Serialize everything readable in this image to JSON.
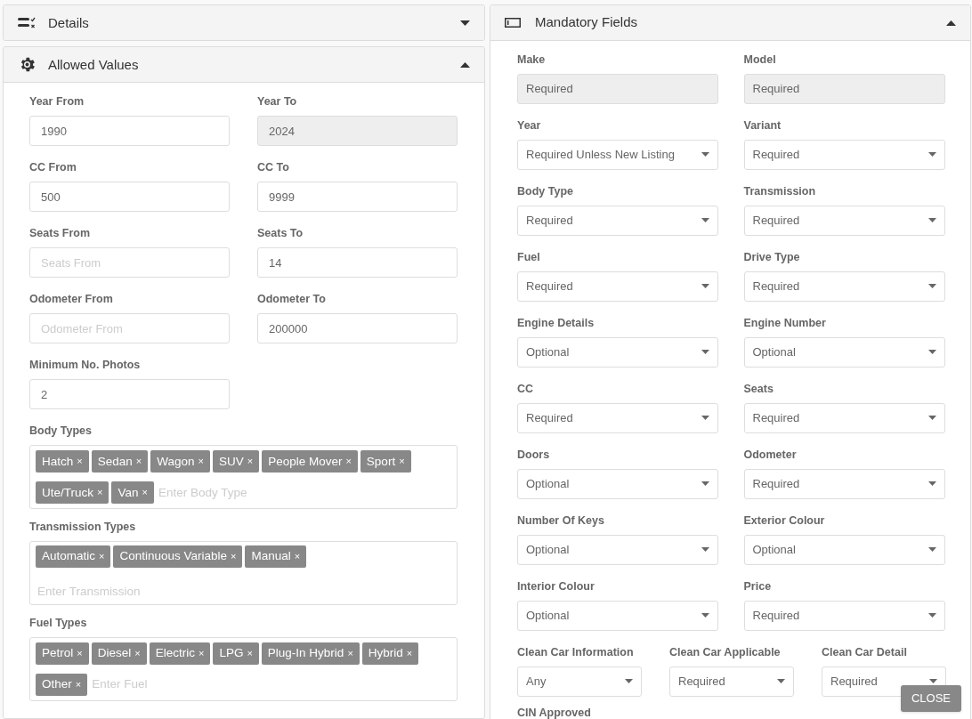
{
  "left_panels": [
    {
      "title": "Details",
      "kind": "list-check",
      "expanded": false
    },
    {
      "title": "Allowed Values",
      "kind": "gear",
      "expanded": true
    }
  ],
  "allowed_values": {
    "fields": [
      {
        "label": "Year From",
        "value": "1990",
        "disabled": false
      },
      {
        "label": "Year To",
        "value": "2024",
        "disabled": true
      },
      {
        "label": "CC From",
        "value": "500",
        "disabled": false
      },
      {
        "label": "CC To",
        "value": "9999",
        "disabled": false
      },
      {
        "label": "Seats From",
        "placeholder": "Seats From",
        "disabled": false
      },
      {
        "label": "Seats To",
        "value": "14",
        "disabled": false
      },
      {
        "label": "Odometer From",
        "placeholder": "Odometer From",
        "disabled": false
      },
      {
        "label": "Odometer To",
        "value": "200000",
        "disabled": false
      },
      {
        "label": "Minimum No. Photos",
        "value": "2",
        "disabled": false
      }
    ],
    "tag_fields": [
      {
        "label": "Body Types",
        "tags": [
          "Hatch",
          "Sedan",
          "Wagon",
          "SUV",
          "People Mover",
          "Sport",
          "Ute/Truck",
          "Van"
        ],
        "placeholder": "Enter Body Type",
        "input_on_new_line": false
      },
      {
        "label": "Transmission Types",
        "tags": [
          "Automatic",
          "Continuous Variable",
          "Manual"
        ],
        "placeholder": "Enter Transmission",
        "input_on_new_line": true
      },
      {
        "label": "Fuel Types",
        "tags": [
          "Petrol",
          "Diesel",
          "Electric",
          "LPG",
          "Plug-In Hybrid",
          "Hybrid",
          "Other"
        ],
        "placeholder": "Enter Fuel",
        "input_on_new_line": false
      }
    ],
    "remove_mark": "×"
  },
  "mandatory_panel": {
    "title": "Mandatory Fields",
    "kind": "rectangle",
    "expanded": true,
    "fields": [
      {
        "label": "Make",
        "value": "Required",
        "kind": "locked"
      },
      {
        "label": "Model",
        "value": "Required",
        "kind": "locked"
      },
      {
        "label": "Year",
        "value": "Required Unless New Listing",
        "kind": "select"
      },
      {
        "label": "Variant",
        "value": "Required",
        "kind": "select"
      },
      {
        "label": "Body Type",
        "value": "Required",
        "kind": "select"
      },
      {
        "label": "Transmission",
        "value": "Required",
        "kind": "select"
      },
      {
        "label": "Fuel",
        "value": "Required",
        "kind": "select"
      },
      {
        "label": "Drive Type",
        "value": "Required",
        "kind": "select"
      },
      {
        "label": "Engine Details",
        "value": "Optional",
        "kind": "select"
      },
      {
        "label": "Engine Number",
        "value": "Optional",
        "kind": "select"
      },
      {
        "label": "CC",
        "value": "Required",
        "kind": "select"
      },
      {
        "label": "Seats",
        "value": "Required",
        "kind": "select"
      },
      {
        "label": "Doors",
        "value": "Optional",
        "kind": "select"
      },
      {
        "label": "Odometer",
        "value": "Required",
        "kind": "select"
      },
      {
        "label": "Number Of Keys",
        "value": "Optional",
        "kind": "select"
      },
      {
        "label": "Exterior Colour",
        "value": "Optional",
        "kind": "select"
      },
      {
        "label": "Interior Colour",
        "value": "Optional",
        "kind": "select"
      },
      {
        "label": "Price",
        "value": "Required",
        "kind": "select"
      }
    ],
    "clean_car_fields": [
      {
        "label": "Clean Car Information",
        "value": "Any",
        "kind": "select"
      },
      {
        "label": "Clean Car Applicable",
        "value": "Required",
        "kind": "select"
      },
      {
        "label": "Clean Car Detail",
        "value": "Required",
        "kind": "select"
      }
    ],
    "next_label": "CIN Approved"
  },
  "close_button": "CLOSE"
}
